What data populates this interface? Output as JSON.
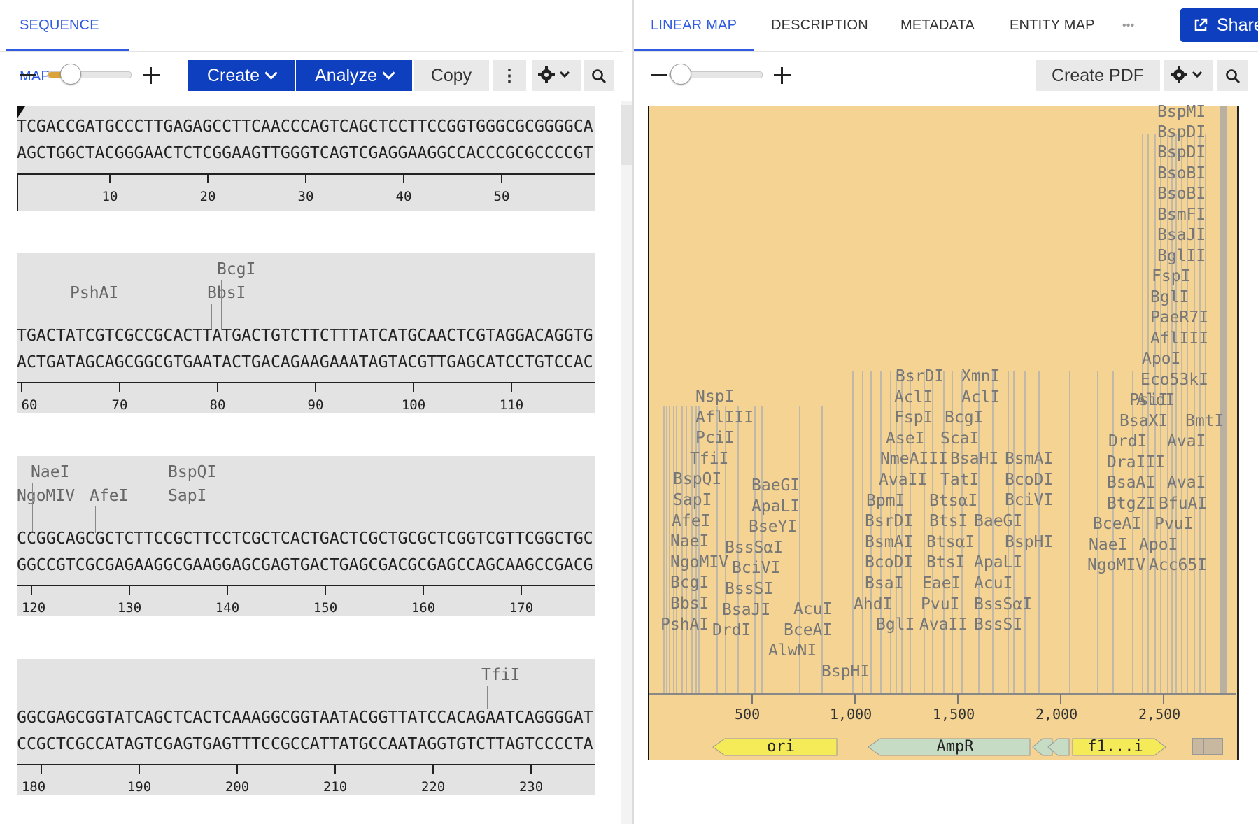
{
  "left_panel": {
    "tab": "SEQUENCE MAP",
    "toolbar": {
      "create": "Create",
      "analyze": "Analyze",
      "copy": "Copy",
      "more": "⋮"
    },
    "blocks": [
      {
        "top": "TCGACCGATGCCCTTGAGAGCCTTCAACCCAGTCAGCTCCTTCCGGTGGGCGCGGGGCA",
        "bottom": "AGCTGGCTACGGGAACTCTCGGAAGTTGGGTCAGTCGAGGAAGGCCACCCGCGCCCCGT",
        "ticks": [
          "10",
          "20",
          "30",
          "40",
          "50"
        ],
        "enzymes": []
      },
      {
        "top": "TGACTATCGTCGCCGCACTTATGACTGTCTTCTTTATCATGCAACTCGTAGGACAGGTG",
        "bottom": "ACTGATAGCAGCGGCGTGAATACTGACAGAAGAAATAGTACGTTGAGCATCCTGTCCAC",
        "ticks": [
          "60",
          "70",
          "80",
          "90",
          "100",
          "110"
        ],
        "enzymes": [
          "BcgI",
          "PshAI",
          "BbsI"
        ]
      },
      {
        "top": "CCGGCAGCGCTCTTCCGCTTCCTCGCTCACTGACTCGCTGCGCTCGGTCGTTCGGCTGC",
        "bottom": "GGCCGTCGCGAGAAGGCGAAGGAGCGAGTGACTGAGCGACGCGAGCCAGCAAGCCGACG",
        "ticks": [
          "120",
          "130",
          "140",
          "150",
          "160",
          "170"
        ],
        "enzymes": [
          "NaeI",
          "BspQI",
          "NgoMIV",
          "AfeI",
          "SapI"
        ]
      },
      {
        "top": "GGCGAGCGGTATCAGCTCACTCAAAGGCGGTAATACGGTTATCCACAGAATCAGGGGAT",
        "bottom": "CCGCTCGCCATAGTCGAGTGAGTTTCCGCCATTATGCCAATAGGTGTCTTAGTCCCCTA",
        "ticks": [
          "180",
          "190",
          "200",
          "210",
          "220",
          "230"
        ],
        "enzymes": [
          "TfiI"
        ]
      }
    ]
  },
  "right_panel": {
    "tabs": [
      "LINEAR MAP",
      "DESCRIPTION",
      "METADATA",
      "ENTITY MAP"
    ],
    "more": "•••",
    "share": "Share",
    "create_pdf": "Create PDF",
    "axis_ticks": [
      "500",
      "1,000",
      "1,500",
      "2,000",
      "2,500"
    ],
    "features": {
      "ori": "ori",
      "ampr": "AmpR",
      "f1": "f1...i"
    },
    "enzymes": {
      "right_col": [
        "BspMI",
        "BspDI",
        "BspDI",
        "BsoBI",
        "BsoBI",
        "BsmFI",
        "BsaJI",
        "BglII",
        "FspI",
        "BglI",
        "PaeR7I",
        "AflIII",
        "ApoI",
        "Eco53kI",
        "PsiI",
        "AloI",
        "BmtI",
        "BsaXI",
        "DrdI",
        "AvaI",
        "DraIII",
        "BsaAI",
        "AvaI",
        "BtgZI",
        "BfuAI",
        "BceAI",
        "PvuI",
        "NaeI",
        "ApoI",
        "NgoMIV",
        "Acc65I"
      ],
      "left_col": [
        "NspI",
        "AflIII",
        "PciI",
        "TfiI",
        "BspQI",
        "SapI",
        "AfeI",
        "NaeI",
        "NgoMIV",
        "BcgI",
        "BbsI",
        "PshAI"
      ],
      "col2": [
        "BaeGI",
        "ApaLI",
        "BseYI",
        "BssSαI",
        "BciVI",
        "BssSI",
        "BsaJI",
        "DrdI"
      ],
      "col3": [
        "AcuI",
        "BceAI",
        "AlwNI",
        "BspHI"
      ],
      "mid_col": [
        "BsrDI",
        "AclI",
        "FspI",
        "AseI",
        "NmeAIII",
        "AvaII",
        "BpmI",
        "BsrDI",
        "BsmAI",
        "BcoDI",
        "BsaI",
        "AhdI",
        "BglI"
      ],
      "mid2": [
        "XmnI",
        "AclI",
        "BcgI",
        "ScaI",
        "BsaHI",
        "TatI",
        "BtsαI",
        "BtsI",
        "BtsαI",
        "BtsI",
        "EaeI",
        "PvuI",
        "AvaII"
      ],
      "mid3": [
        "BsmAI",
        "BcoDI",
        "BciVI",
        "BaeGI",
        "BspHI",
        "ApaLI",
        "AcuI",
        "BssSαI",
        "BssSI"
      ]
    }
  }
}
